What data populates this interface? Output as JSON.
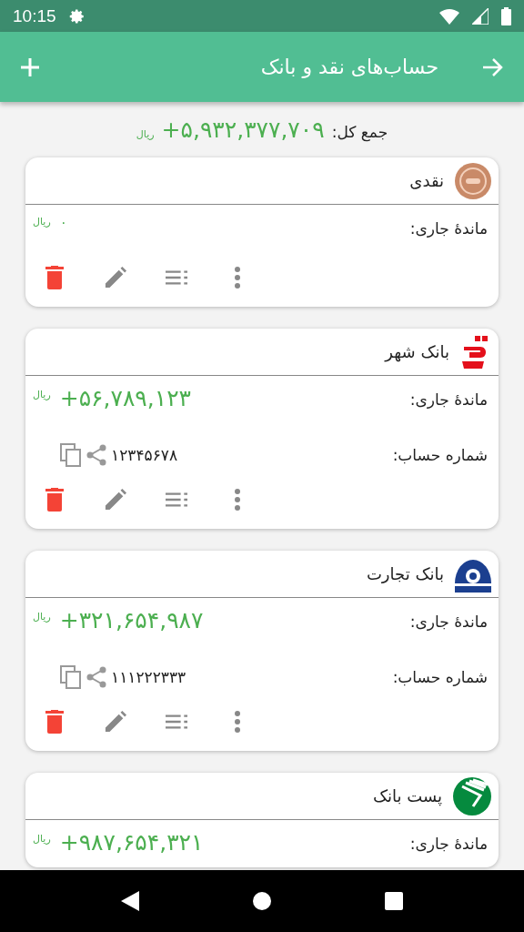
{
  "status_bar": {
    "time": "10:15"
  },
  "app_bar": {
    "title": "حساب‌های نقد و بانک"
  },
  "total": {
    "label": "جمع کل:",
    "amount": "+۵,۹۳۲,۳۷۷,۷۰۹",
    "unit": "ریال"
  },
  "accounts": [
    {
      "name": "نقدی",
      "kind": "coin",
      "balance_label": "ماندهٔ جاری:",
      "balance": "۰",
      "unit": "ریال",
      "large": false
    },
    {
      "name": "بانک شهر",
      "kind": "shahr",
      "balance_label": "ماندهٔ جاری:",
      "balance": "+۵۶,۷۸۹,۱۲۳",
      "unit": "ریال",
      "large": true,
      "account_label": "شماره حساب:",
      "account_number": "۱۲۳۴۵۶۷۸"
    },
    {
      "name": "بانک تجارت",
      "kind": "tejarat",
      "balance_label": "ماندهٔ جاری:",
      "balance": "+۳۲۱,۶۵۴,۹۸۷",
      "unit": "ریال",
      "large": true,
      "account_label": "شماره حساب:",
      "account_number": "۱۱۱۲۲۲۳۳۳"
    },
    {
      "name": "پست بانک",
      "kind": "post",
      "balance_label": "ماندهٔ جاری:",
      "balance": "+۹۸۷,۶۵۴,۳۲۱",
      "unit": "ریال",
      "large": true
    }
  ]
}
